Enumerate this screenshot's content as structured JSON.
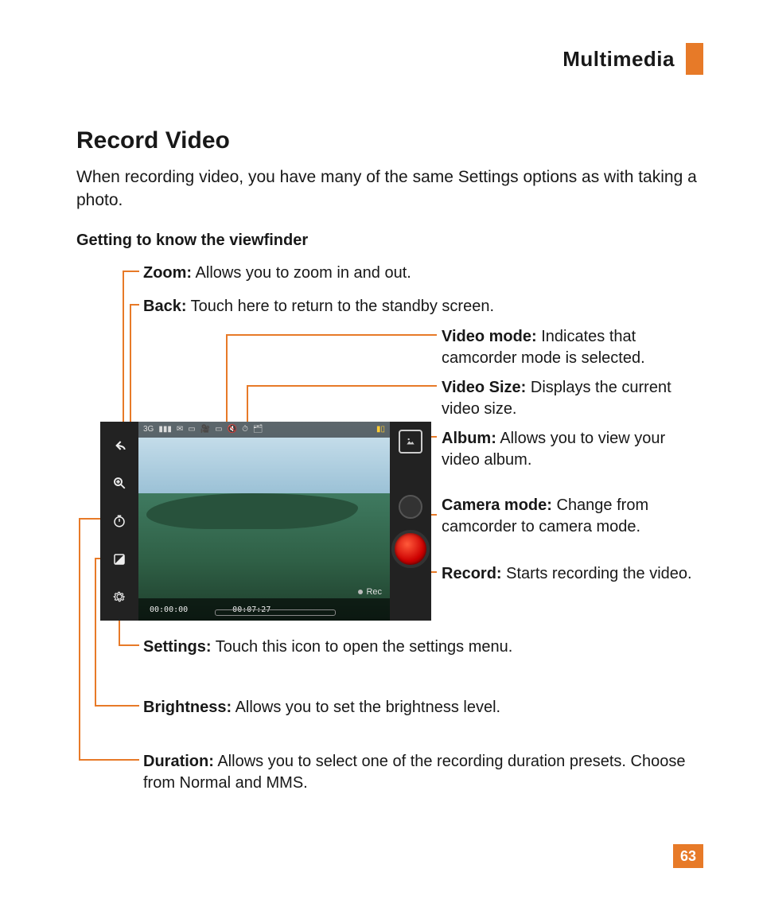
{
  "header": {
    "section": "Multimedia"
  },
  "title": "Record Video",
  "intro": "When recording video, you have many of the same Settings options as with taking a photo.",
  "subhead": "Getting to know the viewfinder",
  "callouts": {
    "zoom": {
      "label": "Zoom:",
      "text": " Allows you to zoom in and out."
    },
    "back": {
      "label": "Back:",
      "text": " Touch here to return to the standby screen."
    },
    "video_mode": {
      "label": "Video mode:",
      "text": " Indicates that camcorder mode is selected."
    },
    "video_size": {
      "label": "Video Size:",
      "text": " Displays the current video size."
    },
    "album": {
      "label": "Album:",
      "text": " Allows you to view your video album."
    },
    "camera_mode": {
      "label": "Camera mode:",
      "text": " Change from camcorder to camera mode."
    },
    "record": {
      "label": "Record:",
      "text": " Starts recording the video."
    },
    "settings": {
      "label": "Settings:",
      "text": " Touch this icon to open the settings menu."
    },
    "brightness": {
      "label": "Brightness:",
      "text": " Allows you to set the brightness level."
    },
    "duration": {
      "label": "Duration:",
      "text": " Allows you to select one of the recording duration presets. Choose from Normal and MMS."
    }
  },
  "viewfinder": {
    "time_elapsed": "00:00:00",
    "time_total": "00:07:27",
    "rec_label": "Rec",
    "status_3g": "3G"
  },
  "page_number": "63",
  "colors": {
    "accent": "#e77a28"
  }
}
